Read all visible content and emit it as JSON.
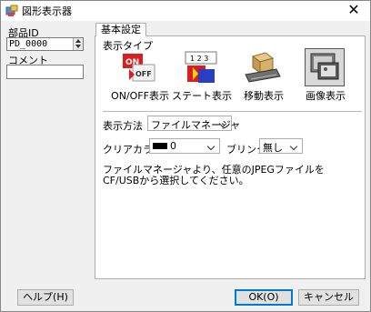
{
  "window": {
    "title": "図形表示器"
  },
  "left": {
    "part_id_label": "部品ID",
    "part_id_value": "PD_0000",
    "comment_label": "コメント",
    "comment_value": ""
  },
  "tabs": [
    {
      "label": "基本設定"
    }
  ],
  "display_type": {
    "label": "表示タイプ",
    "items": [
      {
        "label": "ON/OFF表示",
        "icon": "on-off-icon"
      },
      {
        "label": "ステート表示",
        "icon": "state-icon"
      },
      {
        "label": "移動表示",
        "icon": "move-icon"
      },
      {
        "label": "画像表示",
        "icon": "image-icon",
        "selected": true
      }
    ]
  },
  "display_method": {
    "label": "表示方法",
    "value": "ファイルマネージャ"
  },
  "clear_color": {
    "label": "クリアカラー",
    "value": "0",
    "swatch_color": "#000000"
  },
  "blink": {
    "label": "ブリンク",
    "value": "無し"
  },
  "note": "ファイルマネージャより、任意のJPEGファイルをCF/USBから選択してください。",
  "buttons": {
    "help": "ヘルプ(H)",
    "ok": "OK(O)",
    "cancel": "キャンセル"
  }
}
